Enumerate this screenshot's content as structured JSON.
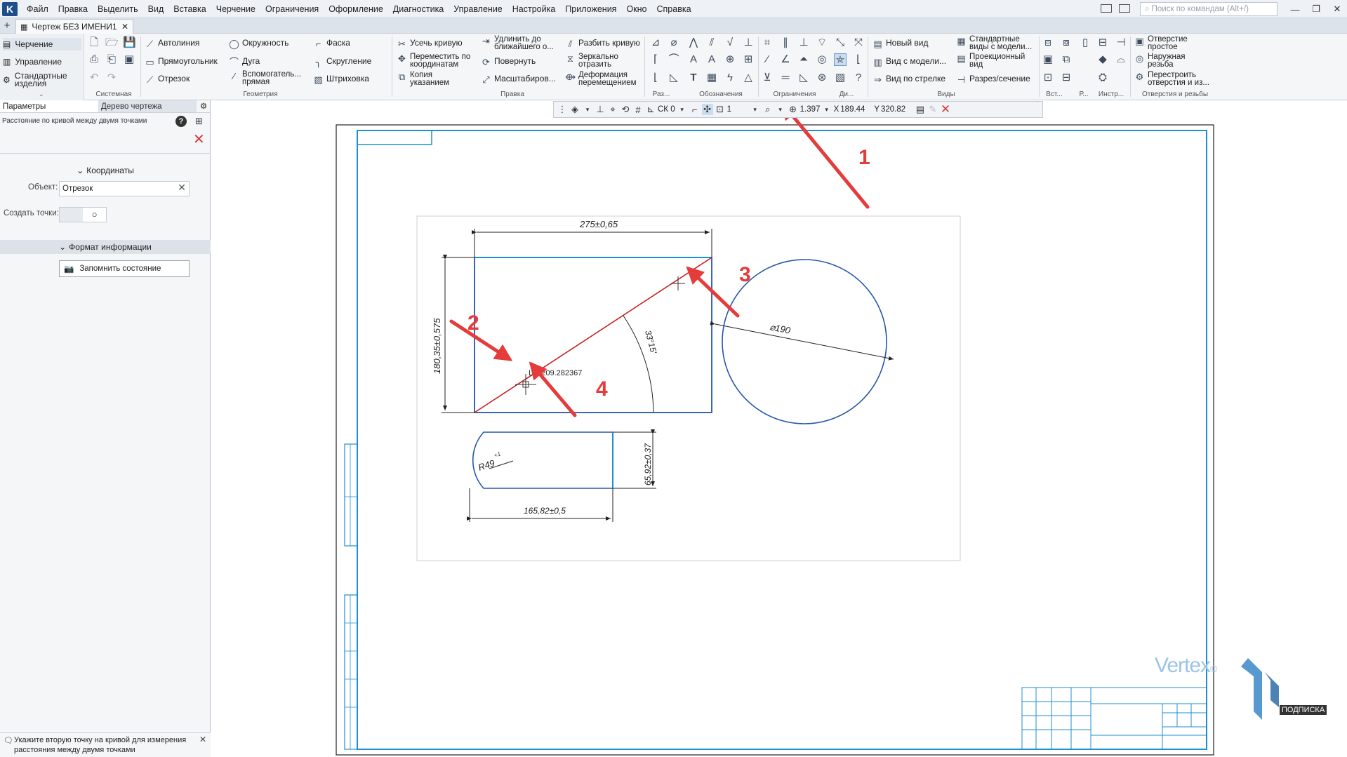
{
  "menubar": {
    "items": [
      "Файл",
      "Правка",
      "Выделить",
      "Вид",
      "Вставка",
      "Черчение",
      "Ограничения",
      "Оформление",
      "Диагностика",
      "Управление",
      "Настройка",
      "Приложения",
      "Окно",
      "Справка"
    ],
    "search_placeholder": "Поиск по командам (Alt+/)"
  },
  "tab": {
    "title": "Чертеж БЕЗ ИМЕНИ1"
  },
  "modes": {
    "drawing": "Черчение",
    "management": "Управление",
    "standard": "Стандартные изделия"
  },
  "ribbon": {
    "geometry": {
      "autoline": "Автолиния",
      "rectangle": "Прямоугольник",
      "segment": "Отрезок",
      "circle": "Окружность",
      "arc": "Дуга",
      "aux_line": "Вспомогатель... прямая",
      "chamfer": "Фаска",
      "fillet": "Скругление",
      "hatch": "Штриховка"
    },
    "edit": {
      "trim": "Усечь кривую",
      "move_coords": "Переместить по координатам",
      "copy": "Копия указанием",
      "extend": "Удлинить до ближайшего о...",
      "rotate": "Повернуть",
      "scale": "Масштабиров...",
      "split": "Разбить кривую",
      "mirror": "Зеркально отразить",
      "deform": "Деформация перемещением"
    },
    "views": {
      "new_view": "Новый вид",
      "model_view": "Вид с модели...",
      "arrow_view": "Вид по стрелке",
      "std_views": "Стандартные виды с модели...",
      "proj_view": "Проекционный вид",
      "section": "Разрез/сечение"
    },
    "holes": {
      "simple_hole": "Отверстие простое",
      "ext_thread": "Наружная резьба",
      "rebuild": "Перестроить отверстия и из..."
    },
    "groups": {
      "system": "Системная",
      "geometry": "Геометрия",
      "edit": "Правка",
      "dims": "Раз...",
      "notation": "Обозначения",
      "constraints": "Ограничения",
      "diag": "Ди...",
      "views": "Виды",
      "insert": "Вст...",
      "r": "Р...",
      "tools": "Инстр...",
      "holes": "Отверстия и резьбы"
    }
  },
  "panel": {
    "tab_params": "Параметры",
    "tab_tree": "Дерево чертежа",
    "op_title": "Расстояние по кривой между двумя точками",
    "section_coords": "Координаты",
    "object_label": "Объект:",
    "object_value": "Отрезок",
    "create_points_label": "Создать точки:",
    "section_format": "Формат информации",
    "remember_button": "Запомнить состояние",
    "status": "Укажите вторую точку на кривой для измерения расстояния между двумя точками"
  },
  "snapbar": {
    "cs": "СК 0",
    "step": "1",
    "zoom": "1.397",
    "x_label": "X",
    "x_value": "189.44",
    "y_label": "Y",
    "y_value": "320.82"
  },
  "drawing": {
    "dim_width_top": "275±0,65",
    "dim_height_left": "180,35±0,575",
    "angle": "33°15'",
    "measure": "L = 209.282367",
    "dia": "⌀190",
    "dim_small_height": "65,92±0,37",
    "dim_small_width": "165,82±0,5",
    "radius": "R49",
    "radius_tol": "+1",
    "markers": [
      "1",
      "2",
      "3",
      "4"
    ]
  },
  "watermark": {
    "brand": "Vertex",
    "subscription": "ПОДПИСКА"
  },
  "colors": {
    "accent_blue": "#1f4e8c",
    "frame_blue": "#1e8fd0",
    "geom_blue": "#2458a8",
    "red_line": "#cc1f1f",
    "arrow_red": "#e53b3b"
  }
}
